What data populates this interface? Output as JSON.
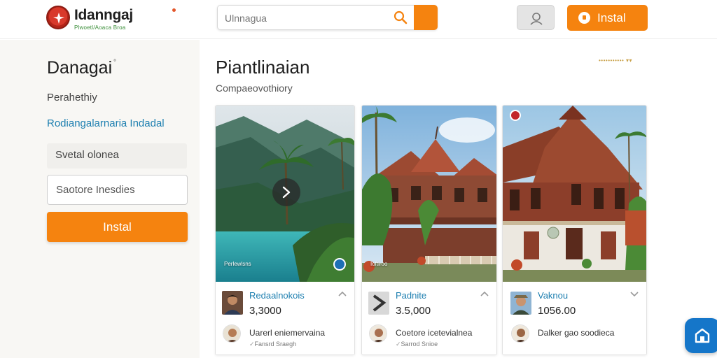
{
  "header": {
    "logo_title": "Idanngaj",
    "logo_subtitle": "Plwoetl/Aoaca Broa",
    "search_placeholder": "Ulnnagua",
    "install_label": "Instal"
  },
  "sidebar": {
    "title": "Danagai",
    "title_mark": "°",
    "item": "Perahethiy",
    "link": "Rodiangalarnaria Indadal",
    "field_label": "Svetal olonea",
    "input_value": "Saotore Inesdies",
    "install_label": "Instal"
  },
  "main": {
    "title": "Piantlinaian",
    "subtitle": "Compaeovothiory",
    "menu_text": "••••••••••• ▾▾",
    "cards": [
      {
        "caption": "Perlewlsns",
        "name": "Redaalnokois",
        "price": "3,3000",
        "description": "Uarerl eniemervaina",
        "meta": "Fansrd Sraegh"
      },
      {
        "caption": "Ioftlroo",
        "name": "Padnite",
        "price": "3.5,000",
        "description": "Coetore icetevialnea",
        "meta": "Sarrod Snioe"
      },
      {
        "caption": "",
        "name": "Vaknou",
        "price": "1056.00",
        "description": "Dalker gao soodieca",
        "meta": ""
      }
    ]
  },
  "colors": {
    "accent": "#f5830f",
    "link": "#1d7fb0",
    "fab": "#1576c9"
  }
}
